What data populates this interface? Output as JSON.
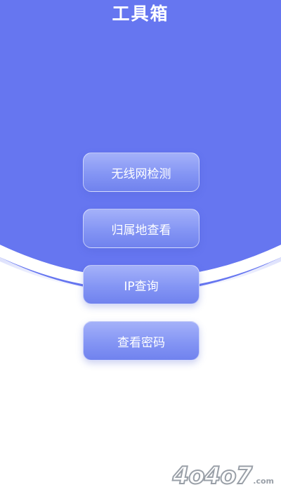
{
  "header": {
    "title": "工具箱"
  },
  "tools": {
    "wifi_check": "无线网检测",
    "location_lookup": "归属地查看",
    "ip_lookup": "IP查询",
    "view_password": "查看密码"
  },
  "watermark": {
    "main": "4o4o7",
    "sub": ".com"
  },
  "colors": {
    "header_blue": "#6676f0",
    "button_gradient_top": "#a4b1f9",
    "button_gradient_bottom": "#7082ee",
    "background": "#ffffff"
  }
}
